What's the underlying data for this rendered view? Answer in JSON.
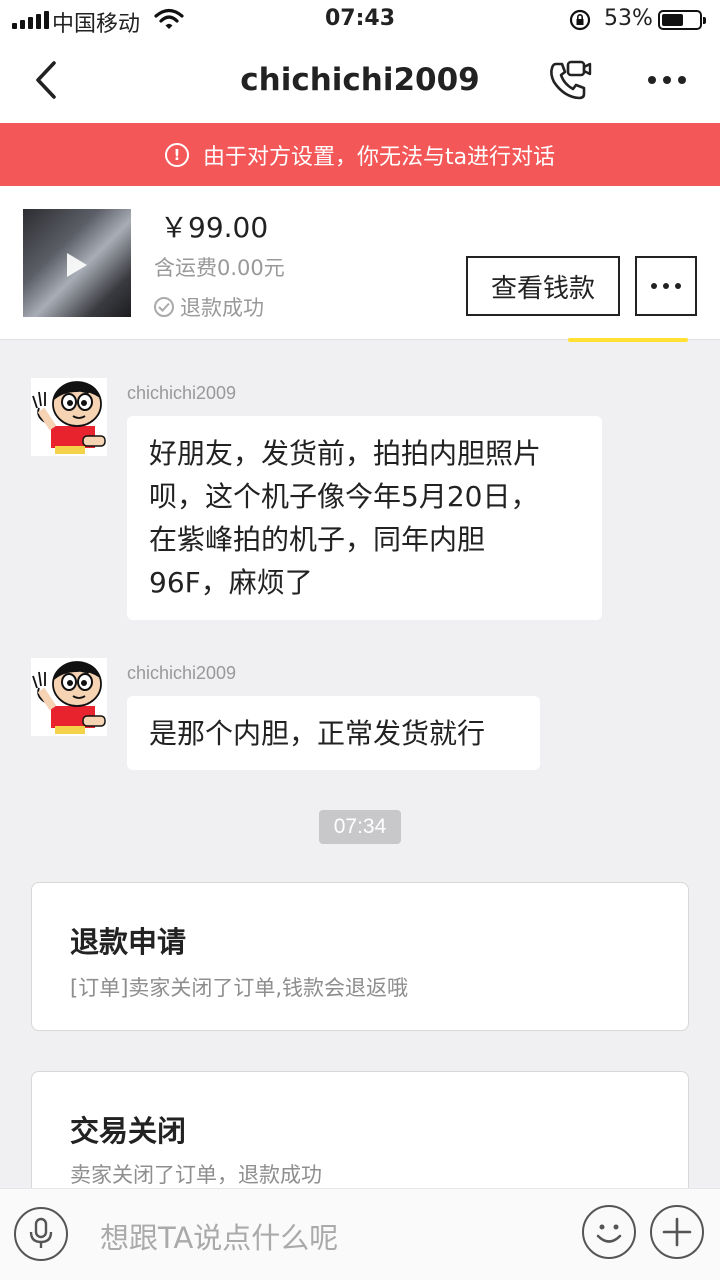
{
  "status_bar": {
    "carrier": "中国移动",
    "time": "07:43",
    "battery_percent": "53%",
    "battery_level": 0.53
  },
  "header": {
    "title": "chichichi2009",
    "icons": [
      "back-arrow-icon",
      "video-call-icon",
      "more-icon"
    ]
  },
  "banner": {
    "text": "由于对方设置，你无法与ta进行对话"
  },
  "product": {
    "price": "￥99.00",
    "shipping": "含运费0.00元",
    "status": "退款成功",
    "view_button": "查看钱款"
  },
  "messages": [
    {
      "sender": "chichichi2009",
      "lines": [
        "好朋友，发货前，拍拍内胆照片",
        "呗，这个机子像今年5月20日，",
        "在紫峰拍的机子，同年内胆",
        "96F，麻烦了"
      ]
    },
    {
      "sender": "chichichi2009",
      "lines": [
        "是那个内胆，正常发货就行"
      ]
    }
  ],
  "timestamp": "07:34",
  "cards": [
    {
      "title": "退款申请",
      "text": "[订单]卖家关闭了订单,钱款会退返哦"
    },
    {
      "title": "交易关闭",
      "text": "卖家关闭了订单，退款成功"
    }
  ],
  "input": {
    "placeholder": "想跟TA说点什么呢"
  }
}
